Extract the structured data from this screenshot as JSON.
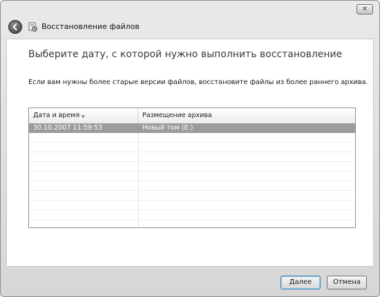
{
  "window": {
    "title": "Восстановление файлов",
    "close_label": "✕"
  },
  "main": {
    "heading": "Выберите дату, с которой нужно выполнить восстановление",
    "description": "Если вам нужны более старые версии файлов, восстановите файлы из более раннего архива."
  },
  "table": {
    "columns": [
      "Дата и время",
      "Размещение архива"
    ],
    "sorted_column": "Дата и время",
    "rows": [
      {
        "datetime": "30.10.2007 11:59:53",
        "location": "Новый том (E:)",
        "selected": true
      }
    ]
  },
  "buttons": {
    "next_label": "Далее",
    "cancel_label": "Отмена"
  },
  "icons": {
    "back": "back-arrow-icon",
    "app": "restore-files-icon",
    "close": "close-icon"
  }
}
